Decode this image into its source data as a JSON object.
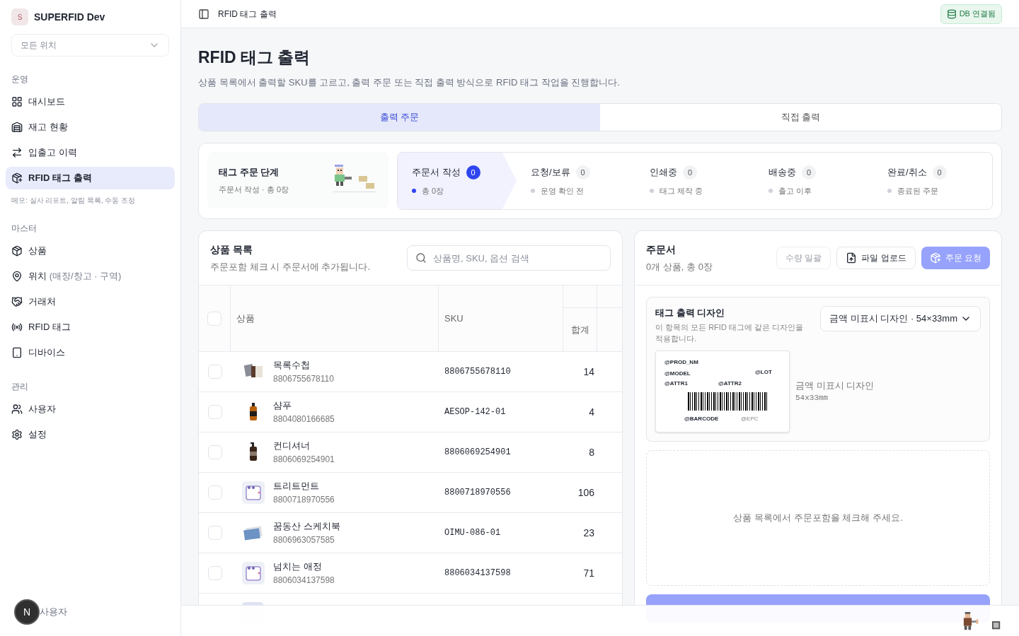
{
  "sidebar": {
    "org_initial": "S",
    "org_name": "SUPERFID Dev",
    "location_select": "모든 위치",
    "sections": [
      {
        "title": "운영",
        "items": [
          {
            "label": "대시보드",
            "selected": false
          },
          {
            "label": "재고 현황",
            "selected": false
          },
          {
            "label": "입출고 이력",
            "selected": false
          },
          {
            "label": "RFID 태그 출력",
            "selected": true
          }
        ],
        "note": "메모: 실사 리포트, 알림 목록, 수동 조정"
      },
      {
        "title": "마스터",
        "items": [
          {
            "label": "상품",
            "selected": false
          },
          {
            "label": "위치",
            "sub": "(매장/창고 · 구역)",
            "selected": false
          },
          {
            "label": "거래처",
            "selected": false
          },
          {
            "label": "RFID 태그",
            "selected": false
          },
          {
            "label": "디바이스",
            "selected": false
          }
        ]
      },
      {
        "title": "관리",
        "items": [
          {
            "label": "사용자",
            "selected": false
          },
          {
            "label": "설정",
            "selected": false
          }
        ]
      }
    ],
    "user_avatar": "N",
    "user_label": "사용자"
  },
  "topbar": {
    "title": "RFID 태그 출력",
    "db_status": "DB 연결됨"
  },
  "page": {
    "title": "RFID 태그 출력",
    "subtitle": "상품 목록에서 출력할 SKU를 고르고, 출력 주문 또는 직접 출력 방식으로 RFID 태그 작업을 진행합니다."
  },
  "tabs": [
    {
      "label": "출력 주문",
      "selected": true
    },
    {
      "label": "직접 출력",
      "selected": false
    }
  ],
  "stage_card": {
    "title": "태그 주문 단계",
    "summary": "주문서 작성 · 총 0장"
  },
  "steps": [
    {
      "label": "주문서 작성",
      "count": "0",
      "note": "총 0장",
      "selected": true
    },
    {
      "label": "요청/보류",
      "count": "0",
      "note": "운영 확인 전",
      "selected": false
    },
    {
      "label": "인쇄중",
      "count": "0",
      "note": "태그 제작 중",
      "selected": false
    },
    {
      "label": "배송중",
      "count": "0",
      "note": "출고 이후",
      "selected": false
    },
    {
      "label": "완료/취소",
      "count": "0",
      "note": "종료된 주문",
      "selected": false
    }
  ],
  "products": {
    "title": "상품 목록",
    "subtitle": "주문포함 체크 시 주문서에 추가됩니다.",
    "search_placeholder": "상품명, SKU, 옵션 검색",
    "columns": {
      "product": "상품",
      "sku": "SKU",
      "total": "합계"
    },
    "header_checked": false,
    "rows": [
      {
        "name": "목록수첩",
        "barcode": "8806755678110",
        "sku": "8806755678110",
        "total": "14",
        "checked": false
      },
      {
        "name": "샴푸",
        "barcode": "8804080166685",
        "sku": "AESOP-142-01",
        "total": "4",
        "checked": false
      },
      {
        "name": "컨디셔너",
        "barcode": "8806069254901",
        "sku": "8806069254901",
        "total": "8",
        "checked": false
      },
      {
        "name": "트리트먼트",
        "barcode": "8800718970556",
        "sku": "8800718970556",
        "total": "106",
        "checked": false
      },
      {
        "name": "꿈동산 스케치북",
        "barcode": "8806963057585",
        "sku": "OIMU-086-01",
        "total": "23",
        "checked": false
      },
      {
        "name": "넘치는 애정",
        "barcode": "8806034137598",
        "sku": "8806034137598",
        "total": "71",
        "checked": false
      }
    ]
  },
  "order": {
    "title": "주문서",
    "summary": "0개 상품, 총 0장",
    "bulk_button": "수량 일괄",
    "upload_button": "파일 업로드",
    "request_button": "주문 요청",
    "design": {
      "title": "태그 출력 디자인",
      "description": "이 항목의 모든 RFID 태그에 같은 디자인을 적용합니다.",
      "select": "금액 미표시 디자인 · 54×33mm",
      "preview_fields": [
        "@PROD_NM",
        "@MODEL",
        "@LOT",
        "@ATTR1",
        "@ATTR2",
        "@BARCODE",
        "@EPC"
      ],
      "name": "금액 미표시 디자인",
      "size": "54x33mm"
    },
    "empty_message": "상품 목록에서 주문포함을 체크해 주세요."
  }
}
